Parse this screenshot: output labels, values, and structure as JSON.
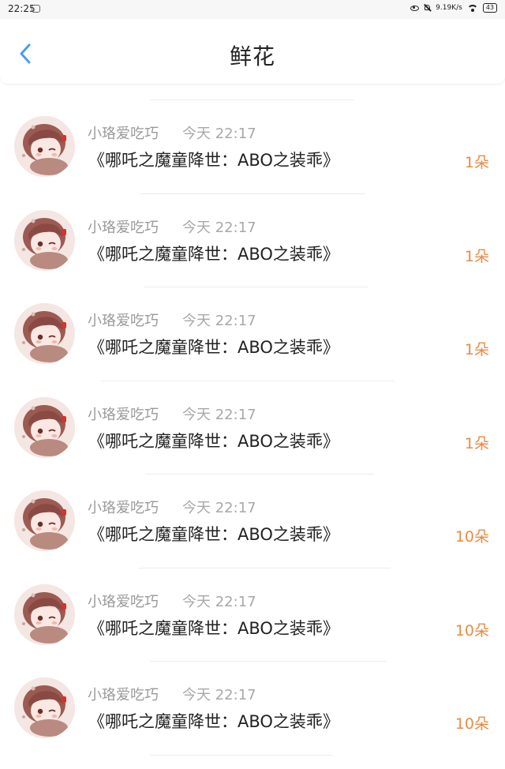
{
  "status_bar": {
    "time": "22:25",
    "speed": "9.19K/s",
    "battery": "43"
  },
  "header": {
    "title": "鲜花",
    "back_icon": "chevron-left-icon",
    "accent_color": "#4a9df0"
  },
  "items": [
    {
      "user": "小珞爱吃巧",
      "time": "今天 22:17",
      "title": "《哪吒之魔童降世：ABO之装乖》",
      "count": "1朵"
    },
    {
      "user": "小珞爱吃巧",
      "time": "今天 22:17",
      "title": "《哪吒之魔童降世：ABO之装乖》",
      "count": "1朵"
    },
    {
      "user": "小珞爱吃巧",
      "time": "今天 22:17",
      "title": "《哪吒之魔童降世：ABO之装乖》",
      "count": "1朵"
    },
    {
      "user": "小珞爱吃巧",
      "time": "今天 22:17",
      "title": "《哪吒之魔童降世：ABO之装乖》",
      "count": "1朵"
    },
    {
      "user": "小珞爱吃巧",
      "time": "今天 22:17",
      "title": "《哪吒之魔童降世：ABO之装乖》",
      "count": "10朵"
    },
    {
      "user": "小珞爱吃巧",
      "time": "今天 22:17",
      "title": "《哪吒之魔童降世：ABO之装乖》",
      "count": "10朵"
    },
    {
      "user": "小珞爱吃巧",
      "time": "今天 22:17",
      "title": "《哪吒之魔童降世：ABO之装乖》",
      "count": "10朵"
    }
  ],
  "colors": {
    "count": "#ec8a43",
    "username": "#9a9a9a",
    "title": "#222222"
  }
}
